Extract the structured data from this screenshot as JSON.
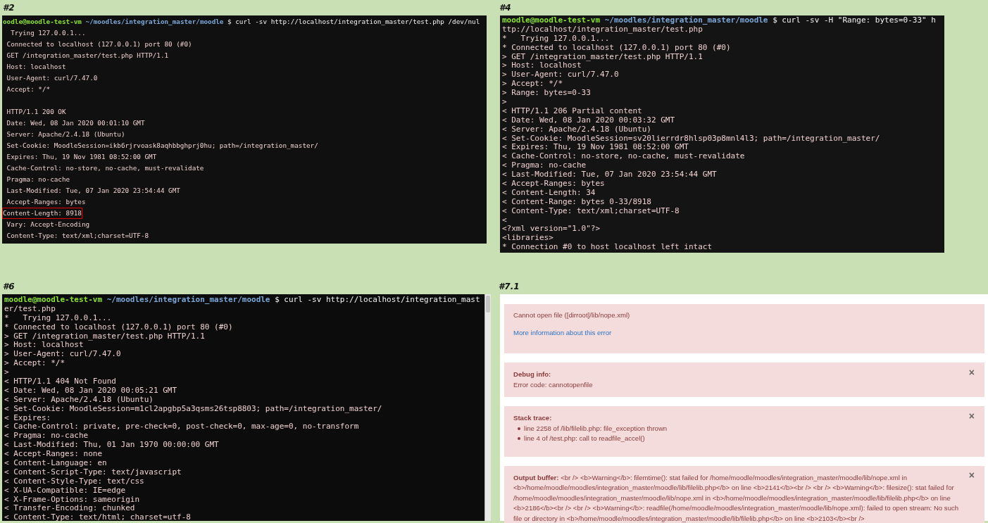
{
  "panels": [
    {
      "label": "#2",
      "kind": "terminal",
      "prompt": {
        "user": "oodle@moodle-test-vm",
        "path": "~/moodles/integration_master/moodle",
        "command": "$ curl -sv http://localhost/integration_master/test.php /dev/nul"
      },
      "lines": [
        {
          "text": "  Trying 127.0.0.1...",
          "highlighted": false
        },
        {
          "text": " Connected to localhost (127.0.0.1) port 80 (#0)",
          "highlighted": false
        },
        {
          "text": " GET /integration_master/test.php HTTP/1.1",
          "highlighted": false
        },
        {
          "text": " Host: localhost",
          "highlighted": false
        },
        {
          "text": " User-Agent: curl/7.47.0",
          "highlighted": false
        },
        {
          "text": " Accept: */*",
          "highlighted": false
        },
        {
          "highlighted": false
        },
        {
          "text": " HTTP/1.1 200 OK",
          "highlighted": false
        },
        {
          "text": " Date: Wed, 08 Jan 2020 00:01:10 GMT",
          "highlighted": false
        },
        {
          "text": " Server: Apache/2.4.18 (Ubuntu)",
          "highlighted": false
        },
        {
          "text": " Set-Cookie: MoodleSession=ikb6rjrvoask8aqhbbghprj0hu; path=/integration_master/",
          "highlighted": false
        },
        {
          "text": " Expires: Thu, 19 Nov 1981 08:52:00 GMT",
          "highlighted": false
        },
        {
          "text": " Cache-Control: no-store, no-cache, must-revalidate",
          "highlighted": false
        },
        {
          "text": " Pragma: no-cache",
          "highlighted": false
        },
        {
          "text": " Last-Modified: Tue, 07 Jan 2020 23:54:44 GMT",
          "highlighted": false
        },
        {
          "text": " Accept-Ranges: bytes",
          "highlighted": false
        },
        {
          "text": "Content-Length: 8918",
          "highlighted": true
        },
        {
          "text": " Vary: Accept-Encoding",
          "highlighted": false
        },
        {
          "text": " Content-Type: text/xml;charset=UTF-8",
          "highlighted": false
        }
      ]
    },
    {
      "label": "#4",
      "kind": "terminal",
      "prompt": {
        "user": "moodle@moodle-test-vm",
        "path": "~/moodles/integration_master/moodle",
        "command": "$ curl -sv -H \"Range: bytes=0-33\" h"
      },
      "lines": [
        {
          "text": "ttp://localhost/integration_master/test.php"
        },
        {
          "text": "*   Trying 127.0.0.1..."
        },
        {
          "text": "* Connected to localhost (127.0.0.1) port 80 (#0)"
        },
        {
          "text": "> GET /integration_master/test.php HTTP/1.1"
        },
        {
          "text": "> Host: localhost"
        },
        {
          "text": "> User-Agent: curl/7.47.0"
        },
        {
          "text": "> Accept: */*"
        },
        {
          "text": "> Range: bytes=0-33"
        },
        {
          "text": ">"
        },
        {
          "text": "< HTTP/1.1 206 Partial content"
        },
        {
          "text": "< Date: Wed, 08 Jan 2020 00:03:32 GMT"
        },
        {
          "text": "< Server: Apache/2.4.18 (Ubuntu)"
        },
        {
          "text": "< Set-Cookie: MoodleSession=sv20lierrdr8hlsp03p8mnl4l3; path=/integration_master/"
        },
        {
          "text": "< Expires: Thu, 19 Nov 1981 08:52:00 GMT"
        },
        {
          "text": "< Cache-Control: no-store, no-cache, must-revalidate"
        },
        {
          "text": "< Pragma: no-cache"
        },
        {
          "text": "< Last-Modified: Tue, 07 Jan 2020 23:54:44 GMT"
        },
        {
          "text": "< Accept-Ranges: bytes"
        },
        {
          "text": "< Content-Length: 34"
        },
        {
          "text": "< Content-Range: bytes 0-33/8918"
        },
        {
          "text": "< Content-Type: text/xml;charset=UTF-8"
        },
        {
          "text": "<"
        },
        {
          "text": "<?xml version=\"1.0\"?>"
        },
        {
          "text": "<libraries>"
        },
        {
          "text": "* Connection #0 to host localhost left intact"
        }
      ]
    },
    {
      "label": "#6",
      "kind": "terminal",
      "prompt": {
        "user": "moodle@moodle-test-vm",
        "path": "~/moodles/integration_master/moodle",
        "command": "$ curl -sv http://localhost/integration_mast"
      },
      "lines": [
        {
          "text": "er/test.php"
        },
        {
          "text": "*   Trying 127.0.0.1..."
        },
        {
          "text": "* Connected to localhost (127.0.0.1) port 80 (#0)"
        },
        {
          "text": "> GET /integration_master/test.php HTTP/1.1"
        },
        {
          "text": "> Host: localhost"
        },
        {
          "text": "> User-Agent: curl/7.47.0"
        },
        {
          "text": "> Accept: */*"
        },
        {
          "text": ">"
        },
        {
          "text": "< HTTP/1.1 404 Not Found"
        },
        {
          "text": "< Date: Wed, 08 Jan 2020 00:05:21 GMT"
        },
        {
          "text": "< Server: Apache/2.4.18 (Ubuntu)"
        },
        {
          "text": "< Set-Cookie: MoodleSession=m1cl2apgbp5a3qsms26tsp8803; path=/integration_master/"
        },
        {
          "text": "< Expires:"
        },
        {
          "text": "< Cache-Control: private, pre-check=0, post-check=0, max-age=0, no-transform"
        },
        {
          "text": "< Pragma: no-cache"
        },
        {
          "text": "< Last-Modified: Thu, 01 Jan 1970 00:00:00 GMT"
        },
        {
          "text": "< Accept-Ranges: none"
        },
        {
          "text": "< Content-Language: en"
        },
        {
          "text": "< Content-Script-Type: text/javascript"
        },
        {
          "text": "< Content-Style-Type: text/css"
        },
        {
          "text": "< X-UA-Compatible: IE=edge"
        },
        {
          "text": "< X-Frame-Options: sameorigin"
        },
        {
          "text": "< Transfer-Encoding: chunked"
        },
        {
          "text": "< Content-Type: text/html; charset=utf-8"
        }
      ]
    },
    {
      "label": "#7.1",
      "kind": "error_page",
      "alerts": [
        {
          "kind": "message",
          "text": "Cannot open file ([dirroot]/lib/nope.xml)",
          "link": "More information about this error"
        },
        {
          "kind": "detail",
          "title": "Debug info:",
          "text": "Error code: cannotopenfile",
          "close": "×"
        },
        {
          "kind": "list",
          "title": "Stack trace:",
          "items": [
            "line 2258 of /lib/filelib.php: file_exception thrown",
            "line 4 of /test.php: call to readfile_accel()"
          ],
          "close": "×"
        },
        {
          "kind": "paragraph",
          "text": "**Output buffer:** <br /> <b>Warning</b>: filemtime(): stat failed for /home/moodle/moodles/integration_master/moodle/lib/nope.xml in <b>/home/moodle/moodles/integration_master/moodle/lib/filelib.php</b> on line <b>2141</b><br /> <br /> <b>Warning</b>: filesize(): stat failed for /home/moodle/moodles/integration_master/moodle/lib/nope.xml in <b>/home/moodle/moodles/integration_master/moodle/lib/filelib.php</b> on line <b>2186</b><br /> <br /> <b>Warning</b>: readfile(/home/moodle/moodles/integration_master/moodle/lib/nope.xml): failed to open stream: No such file or directory in <b>/home/moodle/moodles/integration_master/moodle/lib/filelib.php</b> on line <b>2103</b><br />",
          "close": "×"
        }
      ]
    }
  ]
}
